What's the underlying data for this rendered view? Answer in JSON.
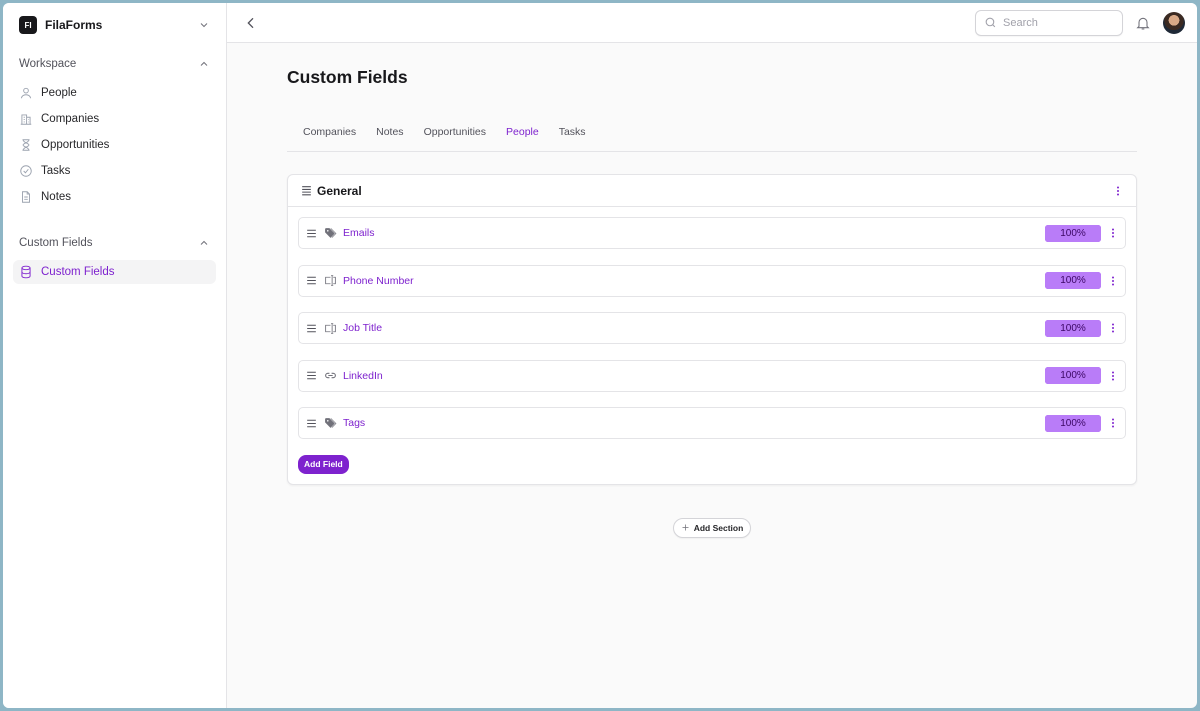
{
  "brand": {
    "logo_text": "FI",
    "name": "FilaForms"
  },
  "sidebar": {
    "groups": [
      {
        "label": "Workspace",
        "items": [
          {
            "label": "People",
            "icon": "user-icon"
          },
          {
            "label": "Companies",
            "icon": "building-icon"
          },
          {
            "label": "Opportunities",
            "icon": "hourglass-icon"
          },
          {
            "label": "Tasks",
            "icon": "check-circle-icon"
          },
          {
            "label": "Notes",
            "icon": "document-icon"
          }
        ]
      },
      {
        "label": "Custom Fields",
        "items": [
          {
            "label": "Custom Fields",
            "icon": "database-icon",
            "active": true
          }
        ]
      }
    ]
  },
  "topbar": {
    "search_placeholder": "Search"
  },
  "page": {
    "title": "Custom Fields",
    "tabs": [
      {
        "label": "Companies"
      },
      {
        "label": "Notes"
      },
      {
        "label": "Opportunities"
      },
      {
        "label": "People",
        "active": true
      },
      {
        "label": "Tasks"
      }
    ]
  },
  "section": {
    "title": "General",
    "fields": [
      {
        "name": "Emails",
        "type_icon": "tag-icon",
        "width_label": "100%",
        "width": 1.0
      },
      {
        "name": "Phone Number",
        "type_icon": "text-input-icon",
        "width_label": "100%",
        "width": 1.0
      },
      {
        "name": "Job Title",
        "type_icon": "text-input-icon",
        "width_label": "100%",
        "width": 1.0
      },
      {
        "name": "LinkedIn",
        "type_icon": "link-icon",
        "width_label": "100%",
        "width": 1.0
      },
      {
        "name": "Tags",
        "type_icon": "tag-icon",
        "width_label": "100%",
        "width": 1.0
      }
    ],
    "add_field_label": "Add Field"
  },
  "add_section_label": "Add Section",
  "colors": {
    "accent": "#7e22ce",
    "badge": "#a855f7"
  }
}
